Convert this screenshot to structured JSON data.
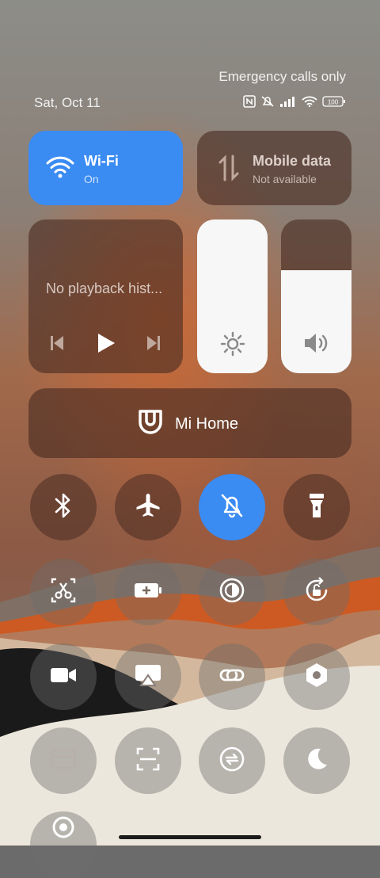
{
  "status": {
    "network_text": "Emergency calls only",
    "date": "Sat, Oct 11",
    "battery": "100"
  },
  "wifi": {
    "title": "Wi-Fi",
    "state": "On"
  },
  "mobile": {
    "title": "Mobile data",
    "state": "Not available"
  },
  "media": {
    "text": "No playback hist..."
  },
  "sliders": {
    "brightness_level": 1.0,
    "volume_level": 0.67
  },
  "mihome": {
    "label": "Mi Home"
  },
  "accent": "#3a8bf2"
}
